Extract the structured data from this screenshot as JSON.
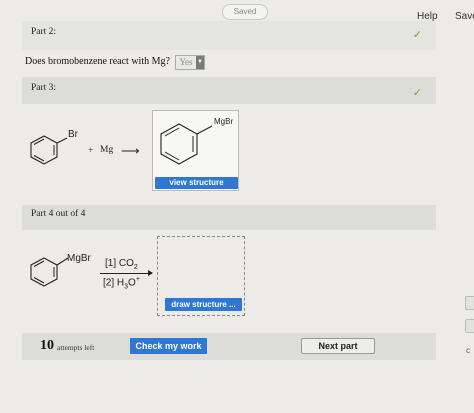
{
  "header": {
    "saved_label": "Saved",
    "help_label": "Help",
    "save_label": "Save"
  },
  "part2": {
    "title": "Part 2:",
    "question": "Does bromobenzene react with Mg?",
    "answer_value": "Yes",
    "check_icon": "check-icon"
  },
  "part3": {
    "title": "Part 3:",
    "reactant_substituent": "Br",
    "plus": "+",
    "reagent": "Mg",
    "arrow": "⟶",
    "product_substituent": "MgBr",
    "view_button_label": "view structure",
    "check_icon": "check-icon"
  },
  "part4": {
    "title": "Part 4 out of 4",
    "reactant_substituent": "MgBr",
    "step1": "[1] CO",
    "step1_sub": "2",
    "step2": "[2] H",
    "step2_sub": "3",
    "step2_tail": "O",
    "step2_sup": "+",
    "draw_button_label": "draw structure ..."
  },
  "footer": {
    "attempts_count": "10",
    "attempts_label": "attempts left",
    "check_button_label": "Check my work",
    "next_button_label": "Next part"
  },
  "edge": {
    "partial_letter": "c"
  },
  "colors": {
    "accent_blue": "#2e77d2",
    "check_green": "#6bab2c",
    "background": "#ecebe8",
    "bar_gray": "#dcdcd9"
  }
}
